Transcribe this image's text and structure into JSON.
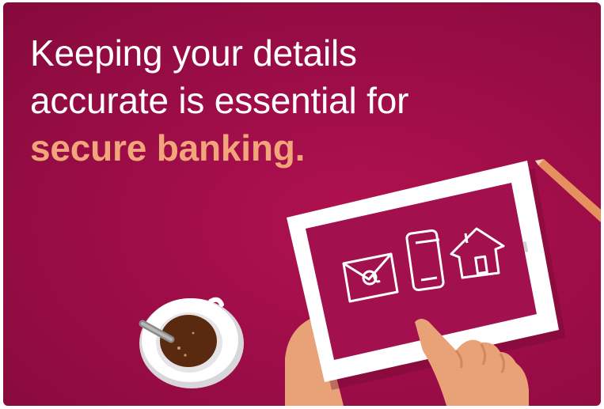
{
  "headline": {
    "line1": "Keeping your details",
    "line2": "accurate is essential for",
    "line3": "secure banking."
  },
  "icons": [
    "email-envelope-icon",
    "mobile-phone-icon",
    "house-icon"
  ],
  "colors": {
    "background": "#9e0d48",
    "accent_text": "#f2a57a",
    "text": "#ffffff"
  }
}
